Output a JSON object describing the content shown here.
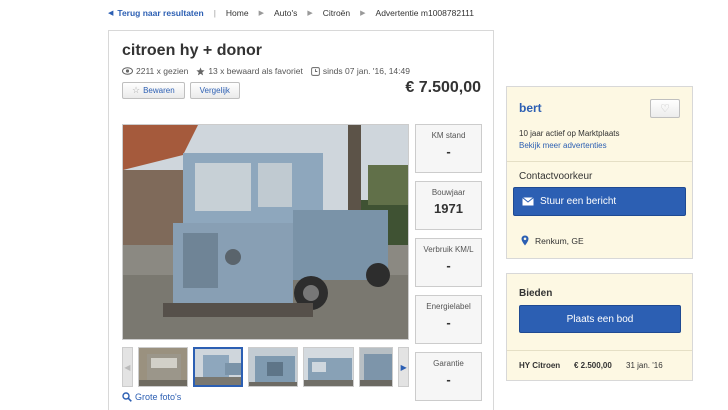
{
  "breadcrumb": {
    "back_label": "Terug naar resultaten",
    "items": [
      "Home",
      "Auto's",
      "Citroën"
    ],
    "ad_label": "Advertentie m1008782111"
  },
  "listing": {
    "title": "citroen hy + donor",
    "views": "2211 x gezien",
    "favorites": "13 x bewaard als favoriet",
    "since": "sinds 07 jan. '16, 14:49",
    "save_label": "Bewaren",
    "compare_label": "Vergelijk",
    "price": "€ 7.500,00",
    "large_photos_label": "Grote foto's"
  },
  "specs": [
    {
      "label": "KM stand",
      "value": "-"
    },
    {
      "label": "Bouwjaar",
      "value": "1971"
    },
    {
      "label": "Verbruik KM/L",
      "value": "-"
    },
    {
      "label": "Energielabel",
      "value": "-"
    },
    {
      "label": "Garantie",
      "value": "-"
    }
  ],
  "seller": {
    "name": "bert",
    "active": "10 jaar actief op Marktplaats",
    "more_ads": "Bekijk meer advertenties",
    "contact_pref": "Contactvoorkeur",
    "message_button": "Stuur een bericht",
    "location": "Renkum, GE"
  },
  "bidding": {
    "title": "Bieden",
    "place_bid_button": "Plaats een bod",
    "bids": [
      {
        "name": "HY Citroen",
        "amount": "€ 2.500,00",
        "date": "31 jan. '16"
      }
    ]
  },
  "colors": {
    "link_blue": "#2c5fb3",
    "seller_bg": "#fdf8e3",
    "van_blue": "#8ea7bd"
  },
  "icons": {
    "views": "eye-icon",
    "favorites": "star-icon",
    "since": "clock-icon",
    "save": "star-outline-icon",
    "follow": "heart-icon",
    "message": "envelope-icon",
    "location": "map-pin-icon",
    "large_photos": "magnifier-icon"
  }
}
